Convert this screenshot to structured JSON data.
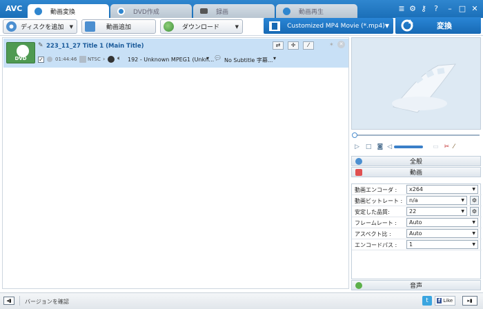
{
  "app": {
    "logo": "AVC"
  },
  "tabs": [
    {
      "label": "動画変換"
    },
    {
      "label": "DVD作成"
    },
    {
      "label": "録画"
    },
    {
      "label": "動画再生"
    }
  ],
  "window_controls": {
    "menu_icon": "menu-icon",
    "gear_icon": "gear-icon",
    "key_icon": "key-icon",
    "help": "?",
    "minimize": "–",
    "maximize": "□",
    "close": "✕"
  },
  "toolbar": {
    "add_disc": "ディスクを追加",
    "add_video": "動画追加",
    "download": "ダウンロード"
  },
  "profile": {
    "label": "Customized MP4 Movie (*.mp4)"
  },
  "convert": {
    "label": "変換"
  },
  "item": {
    "title": "223_11_27 Title 1 (Main Title)",
    "duration": "01:44:46",
    "standard": "NTSC",
    "audio": "192 - Unknown MPEG1 (Unkn…",
    "subtitle": "No Subtitle 字幕...",
    "thumb_label": "DVD"
  },
  "settings": {
    "general_label": "全般",
    "video_label": "動画",
    "audio_label": "音声",
    "rows": [
      {
        "label": "動画エンコーダ :",
        "value": "x264"
      },
      {
        "label": "動画ビットレート :",
        "value": "n/a"
      },
      {
        "label": "安定した品質:",
        "value": "22"
      },
      {
        "label": "フレームレート :",
        "value": "Auto"
      },
      {
        "label": "アスペクト比 :",
        "value": "Auto"
      },
      {
        "label": "エンコードパス :",
        "value": "1"
      }
    ]
  },
  "status": {
    "check_version": "バージョンを確認",
    "like": "Like"
  },
  "colors": {
    "accent": "#1b6fb8",
    "selection": "#c8e0f6",
    "thumb": "#4f9a52"
  }
}
